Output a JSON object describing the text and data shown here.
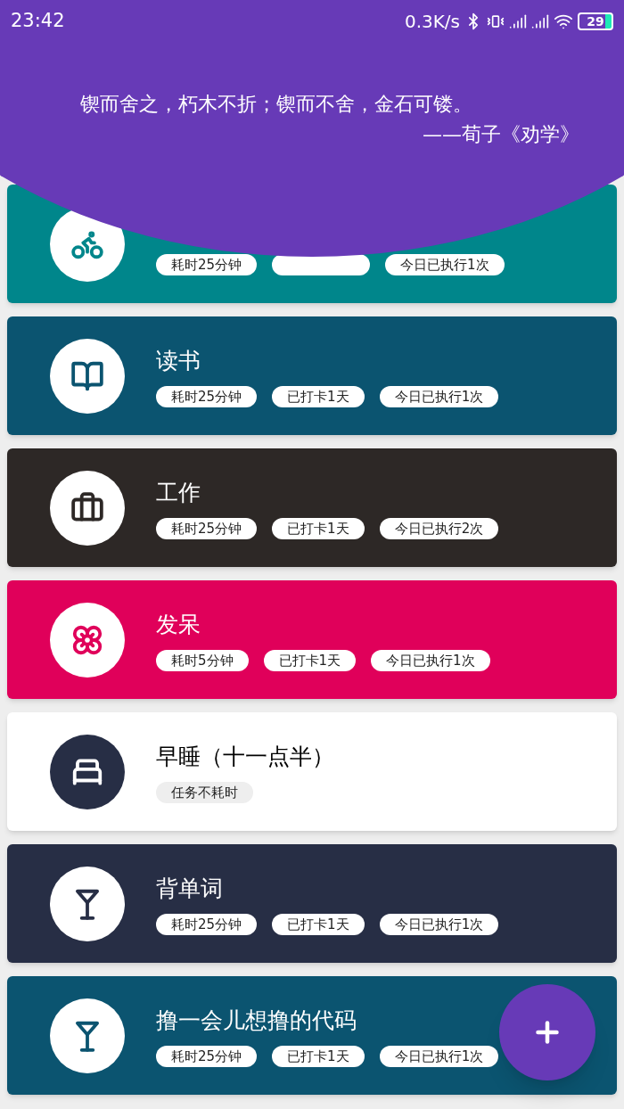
{
  "status_bar": {
    "time": "23:42",
    "speed": "0.3K/s",
    "battery": "29"
  },
  "quote": {
    "text": "锲而舍之，朽木不折；锲而不舍，金石可镂。",
    "source": "——荀子《劝学》"
  },
  "tasks": [
    {
      "kind": "colored",
      "color": "#00868b",
      "covered_tag": true,
      "tags": [
        "耗时25分钟",
        "今日已执行1次"
      ]
    },
    {
      "kind": "colored",
      "color": "#0b5470",
      "title": "读书",
      "tags": [
        "耗时25分钟",
        "已打卡1天",
        "今日已执行1次"
      ]
    },
    {
      "kind": "colored",
      "color": "#2d2826",
      "title": "工作",
      "tags": [
        "耗时25分钟",
        "已打卡1天",
        "今日已执行2次"
      ]
    },
    {
      "kind": "colored",
      "color": "#e0005a",
      "title": "发呆",
      "tags": [
        "耗时5分钟",
        "已打卡1天",
        "今日已执行1次"
      ]
    },
    {
      "kind": "light",
      "color": "#272e45",
      "title": "早睡（十一点半）",
      "tags": [
        "任务不耗时"
      ]
    },
    {
      "kind": "colored",
      "color": "#272e45",
      "title": "背单词",
      "tags": [
        "耗时25分钟",
        "已打卡1天",
        "今日已执行1次"
      ]
    },
    {
      "kind": "colored",
      "color": "#0b5470",
      "title": "撸一会儿想撸的代码",
      "tags": [
        "耗时25分钟",
        "已打卡1天",
        "今日已执行1次"
      ]
    }
  ]
}
